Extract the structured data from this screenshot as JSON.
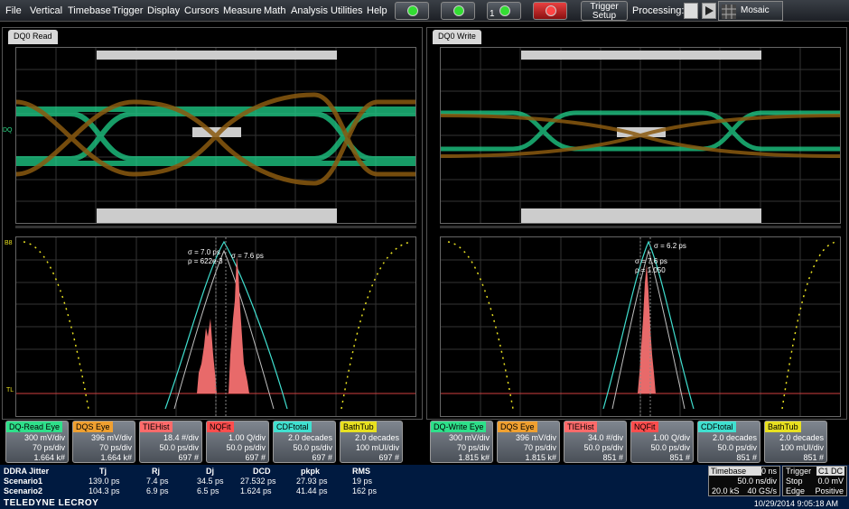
{
  "menu": [
    "File",
    "Vertical",
    "Timebase",
    "Trigger",
    "Display",
    "Cursors",
    "Measure",
    "Math",
    "Analysis",
    "Utilities",
    "Help"
  ],
  "toolbar": {
    "trigger_setup_line1": "Trigger",
    "trigger_setup_line2": "Setup",
    "processing_label": "Processing:",
    "mosaic_label": "Mosaic",
    "counter": "1"
  },
  "left_panel": {
    "tab": "DQ0 Read",
    "ann1": "σ = 7.0 ps",
    "ann2": "ρ = 622e-3",
    "ann3": "σ = 7.6 ps"
  },
  "right_panel": {
    "tab": "DQ0 Write",
    "ann1": "σ = 6.2 ps",
    "ann2": "σ = 7.6 ps",
    "ann3": "ρ = 1.050"
  },
  "marker_dq": "DQ",
  "marker_tl": "TL",
  "marker_b": "B8",
  "left_descriptors": [
    {
      "title": "DQ-Read Eye",
      "color": "#2ee08a",
      "l1": "300 mV/div",
      "l2": "70 ps/div",
      "l3": "1.664 k#"
    },
    {
      "title": "DQS Eye",
      "color": "#f0a030",
      "l1": "396 mV/div",
      "l2": "70 ps/div",
      "l3": "1.664 k#"
    },
    {
      "title": "TIEHist",
      "color": "#ff6a6a",
      "l1": "18.4 #/div",
      "l2": "50.0 ps/div",
      "l3": "697 #"
    },
    {
      "title": "NQFit",
      "color": "#ff4d4d",
      "l1": "1.00 Q/div",
      "l2": "50.0 ps/div",
      "l3": "697 #"
    },
    {
      "title": "CDFtotal",
      "color": "#40e0d0",
      "l1": "2.0 decades",
      "l2": "50.0 ps/div",
      "l3": "697 #"
    },
    {
      "title": "BathTub",
      "color": "#e8e020",
      "l1": "2.0 decades",
      "l2": "100 mUI/div",
      "l3": "697 #"
    }
  ],
  "right_descriptors": [
    {
      "title": "DQ-Write Eye",
      "color": "#2ee08a",
      "l1": "300 mV/div",
      "l2": "70 ps/div",
      "l3": "1.815 k#"
    },
    {
      "title": "DQS Eye",
      "color": "#f0a030",
      "l1": "396 mV/div",
      "l2": "70 ps/div",
      "l3": "1.815 k#"
    },
    {
      "title": "TIEHist",
      "color": "#ff6a6a",
      "l1": "34.0 #/div",
      "l2": "50.0 ps/div",
      "l3": "851 #"
    },
    {
      "title": "NQFit",
      "color": "#ff4d4d",
      "l1": "1.00 Q/div",
      "l2": "50.0 ps/div",
      "l3": "851 #"
    },
    {
      "title": "CDFtotal",
      "color": "#40e0d0",
      "l1": "2.0 decades",
      "l2": "50.0 ps/div",
      "l3": "851 #"
    },
    {
      "title": "BathTub",
      "color": "#e8e020",
      "l1": "2.0 decades",
      "l2": "100 mUI/div",
      "l3": "851 #"
    }
  ],
  "stats": {
    "title": "DDRA Jitter",
    "headers": [
      "Tj",
      "Rj",
      "Dj",
      "DCD",
      "pkpk",
      "RMS"
    ],
    "rows": [
      {
        "name": "Scenario1",
        "vals": [
          "139.0 ps",
          "7.4 ps",
          "34.5 ps",
          "27.532 ps",
          "27.93 ps",
          "19 ps"
        ]
      },
      {
        "name": "Scenario2",
        "vals": [
          "104.3 ps",
          "6.9 ps",
          "6.5 ps",
          "1.624 ps",
          "41.44 ps",
          "162 ps"
        ]
      }
    ]
  },
  "timebase": {
    "label": "Timebase",
    "offset": "0 ns",
    "rate": "50.0 ns/div",
    "samples": "20.0 kS",
    "sr": "40 GS/s"
  },
  "trigger": {
    "label": "Trigger",
    "channel": "C1 DC",
    "mode": "Stop",
    "level": "0.0 mV",
    "type": "Edge",
    "slope": "Positive"
  },
  "datetime": "10/29/2014 9:05:18 AM",
  "brand": "TELEDYNE LECROY"
}
